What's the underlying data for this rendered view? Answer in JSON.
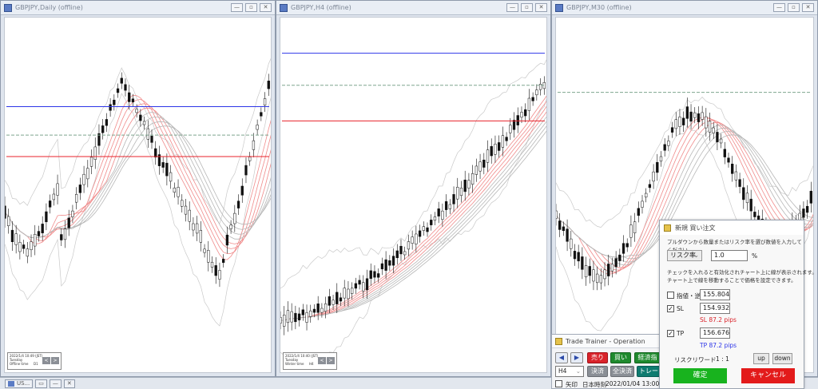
{
  "colors": {
    "blue_line": "#2d35e8",
    "red_line": "#e8232b",
    "buy": "#1f8a2e",
    "sell": "#d9232a"
  },
  "windows": [
    {
      "title": "GBPJPY,Daily (offline)",
      "info": [
        "2022/1/4 10:49 (JST)",
        "Tuesday",
        "Offline time",
        "D1"
      ]
    },
    {
      "title": "GBPJPY,H4 (offline)",
      "info": [
        "2022/1/4 10:40 (JST)",
        "Tuesday",
        "Winter time",
        "H4"
      ]
    },
    {
      "title": "GBPJPY,M30 (offline)"
    }
  ],
  "taskbar": {
    "item1": "US..."
  },
  "trade_trainer": {
    "title": "Trade Trainer - Operation",
    "prev": "◀",
    "next": "▶",
    "sell": "売り",
    "buy": "買い",
    "close_lot": "経済指",
    "timeframe": "H4",
    "settle": "決済",
    "settle_all": "全決済",
    "trail": "トレー",
    "arrow_label": "矢印",
    "clock_label": "日本時刻",
    "clock_value": "2022/01/04 13:00:00"
  },
  "order_dialog": {
    "title": "新規 買い注文",
    "instruction": "プルダウンから数量またはリスク率を選び数値を入力してください。",
    "mode": "リスク率",
    "mode_value": "1.0",
    "mode_unit": "%",
    "hint1": "チェックを入れると有効化されチャート上に線が表示されます。",
    "hint2": "チャート上で線を移動することで価格を設定できます。",
    "limit_label": "指値・逆指値",
    "limit_value": "155.804",
    "limit_checked": false,
    "sl_label": "SL",
    "sl_value": "154.932",
    "sl_checked": true,
    "sl_pips": "SL 87.2 pips",
    "tp_label": "TP",
    "tp_value": "156.676",
    "tp_checked": true,
    "tp_pips": "TP 87.2 pips",
    "rr_label": "リスクリワード",
    "rr_value": "1 : 1",
    "up": "up",
    "down": "down",
    "confirm": "確定",
    "cancel": "キャンセル"
  }
}
